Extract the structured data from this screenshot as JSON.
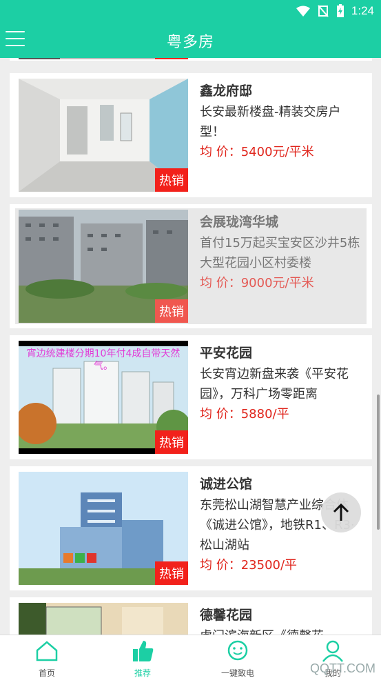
{
  "status": {
    "time": "1:24"
  },
  "header": {
    "title": "粤多房"
  },
  "listings": [
    {
      "name": "鑫龙府邸",
      "desc": "长安最新楼盘-精装交房户型！",
      "price": "均 价：5400元/平米",
      "tag": "热销"
    },
    {
      "name": "会展珑湾华城",
      "desc": "首付15万起买宝安区沙井5栋大型花园小区村委楼",
      "price": "均 价：9000元/平米",
      "tag": "热销"
    },
    {
      "name": "平安花园",
      "desc": "长安宵边新盘来袭《平安花园》，万科广场零距离",
      "price": "均 价：5880/平",
      "tag": "热销",
      "banner": "宵边统建楼分期10年付4成自带天然气。"
    },
    {
      "name": "诚进公馆",
      "desc": "东莞松山湖智慧产业综合体《诚进公馆》，地铁R1、R3·松山湖站",
      "price": "均 价：23500/平",
      "tag": "热销"
    },
    {
      "name": "德馨花园",
      "desc": "虎门滨海新区《德馨花",
      "price": "",
      "tag": ""
    }
  ],
  "nav": {
    "tabs": [
      {
        "label": "首页"
      },
      {
        "label": "推荐"
      },
      {
        "label": "一键致电"
      },
      {
        "label": "我的"
      }
    ]
  },
  "watermark": "QQTT.COM",
  "colors": {
    "accent": "#1ccfa4",
    "hot": "#f2211b",
    "price": "#e0261d"
  }
}
